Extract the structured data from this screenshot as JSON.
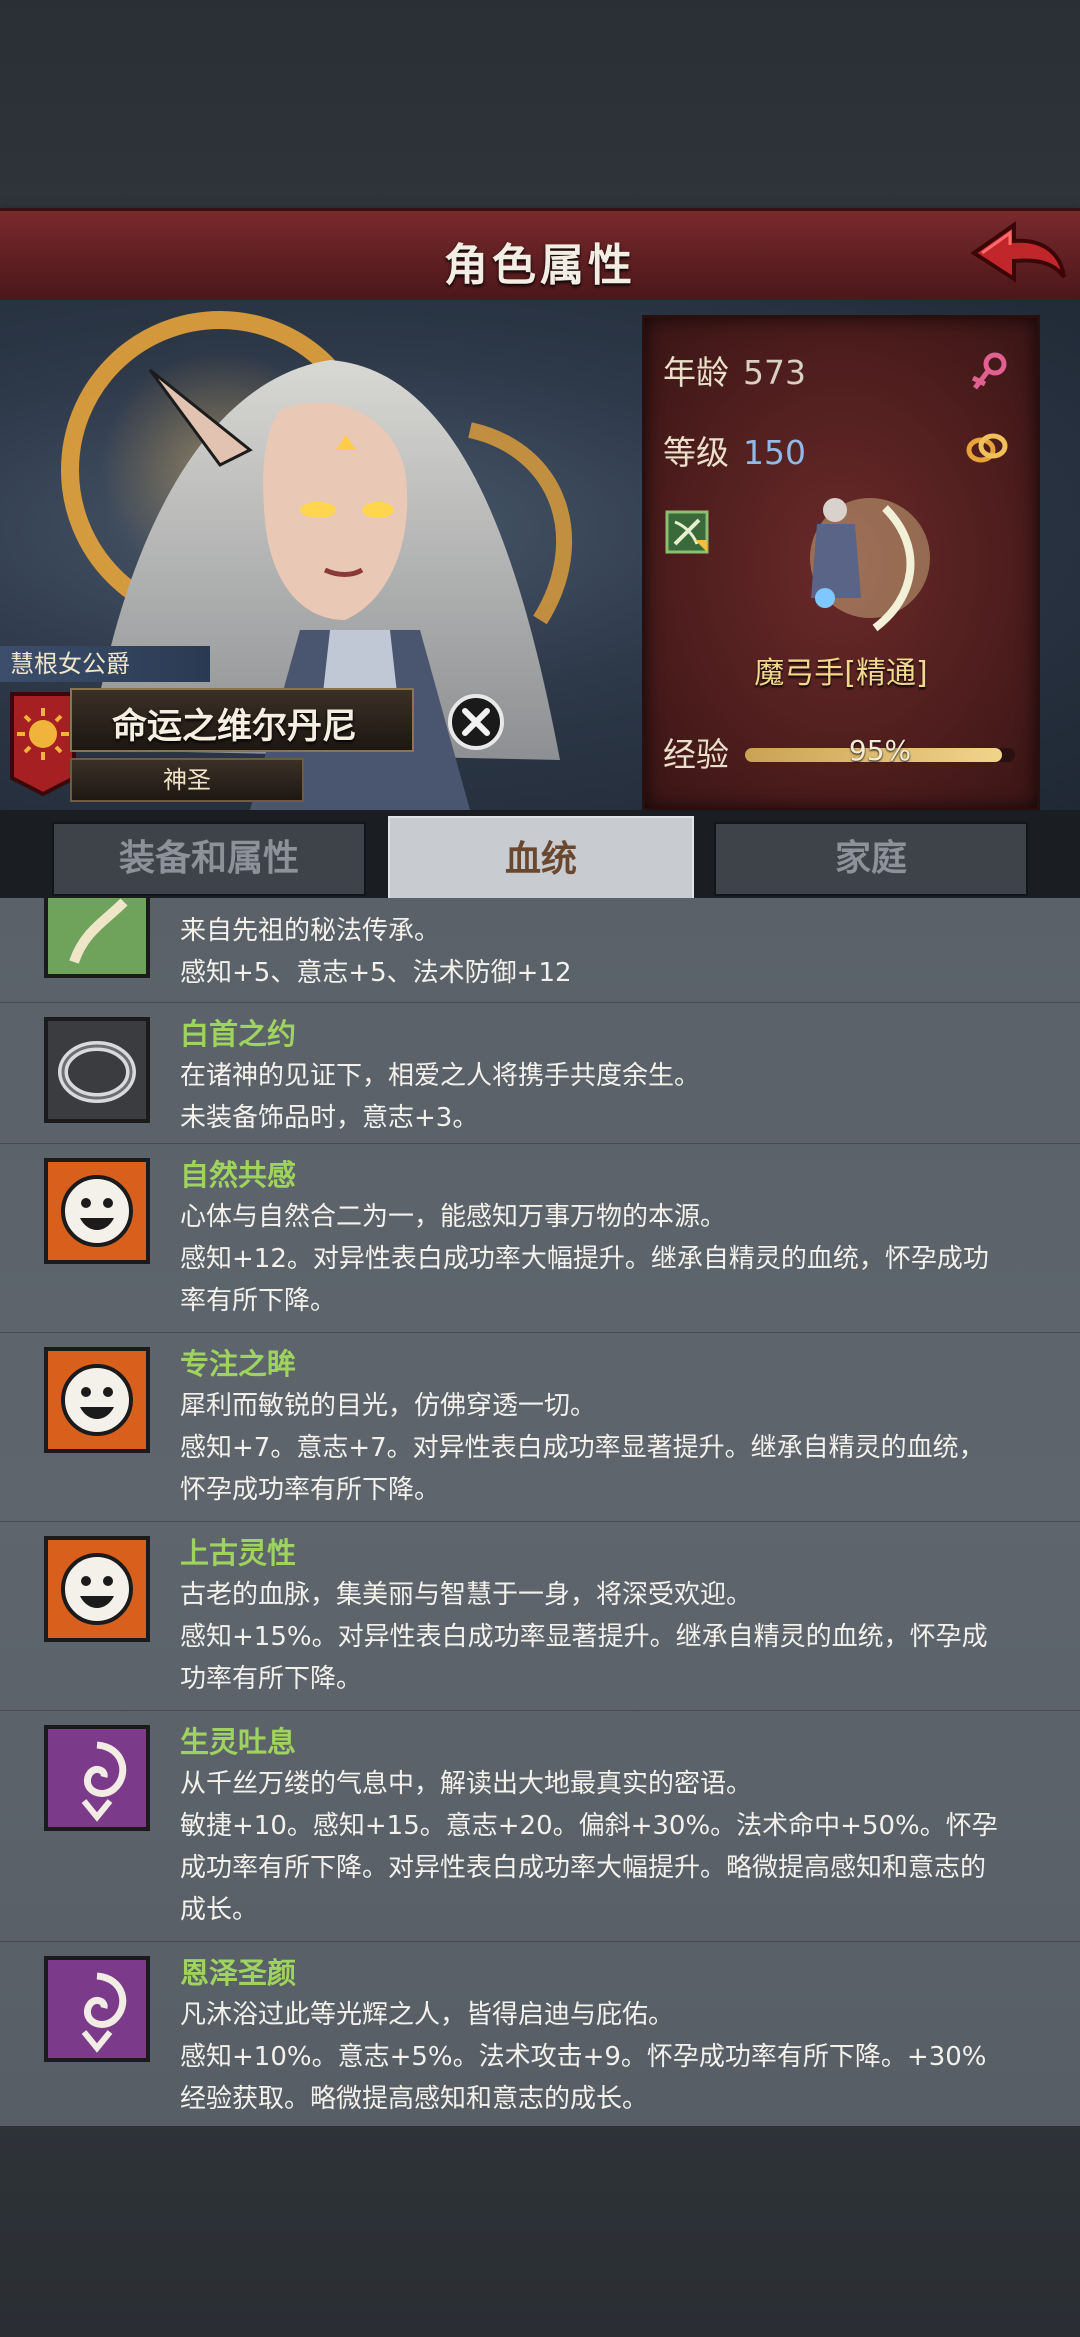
{
  "header": {
    "title": "角色属性"
  },
  "character": {
    "title_tag": "慧根女公爵",
    "name": "命运之维尔丹尼",
    "trait_tag": "神圣"
  },
  "stats": {
    "age_label": "年龄",
    "age": "573",
    "level_label": "等级",
    "level": "150",
    "class_name": "魔弓手[精通]",
    "exp_label": "经验",
    "exp_percent_text": "95%",
    "exp_fraction": 0.95
  },
  "tabs": [
    {
      "label": "装备和属性"
    },
    {
      "label": "血统"
    },
    {
      "label": "家庭"
    }
  ],
  "traits": [
    {
      "name": "",
      "icon": "root-icon",
      "lines": [
        "来自先祖的秘法传承。",
        "感知+5、意志+5、法术防御+12"
      ]
    },
    {
      "name": "白首之约",
      "icon": "ring-icon",
      "lines": [
        "在诸神的见证下，相爱之人将携手共度余生。",
        "未装备饰品时，意志+3。"
      ]
    },
    {
      "name": "自然共感",
      "icon": "smiley-icon",
      "lines": [
        "心体与自然合二为一，能感知万事万物的本源。",
        "感知+12。对异性表白成功率大幅提升。继承自精灵的血统，怀孕成功",
        "率有所下降。"
      ]
    },
    {
      "name": "专注之眸",
      "icon": "smiley-icon",
      "lines": [
        "犀利而敏锐的目光，仿佛穿透一切。",
        "感知+7。意志+7。对异性表白成功率显著提升。继承自精灵的血统，",
        "怀孕成功率有所下降。"
      ]
    },
    {
      "name": "上古灵性",
      "icon": "smiley-icon",
      "lines": [
        "古老的血脉，集美丽与智慧于一身，将深受欢迎。",
        "感知+15%。对异性表白成功率显著提升。继承自精灵的血统，怀孕成",
        "功率有所下降。"
      ]
    },
    {
      "name": "生灵吐息",
      "icon": "spirit-swirl-icon",
      "lines": [
        "从千丝万缕的气息中，解读出大地最真实的密语。",
        "敏捷+10。感知+15。意志+20。偏斜+30%。法术命中+50%。怀孕",
        "成功率有所下降。对异性表白成功率大幅提升。略微提高感知和意志的",
        "成长。"
      ]
    },
    {
      "name": "恩泽圣颜",
      "icon": "spirit-swirl-icon",
      "lines": [
        "凡沐浴过此等光辉之人，皆得启迪与庇佑。",
        "感知+10%。意志+5%。法术攻击+9。怀孕成功率有所下降。+30%",
        "经验获取。略微提高感知和意志的成长。"
      ]
    }
  ]
}
